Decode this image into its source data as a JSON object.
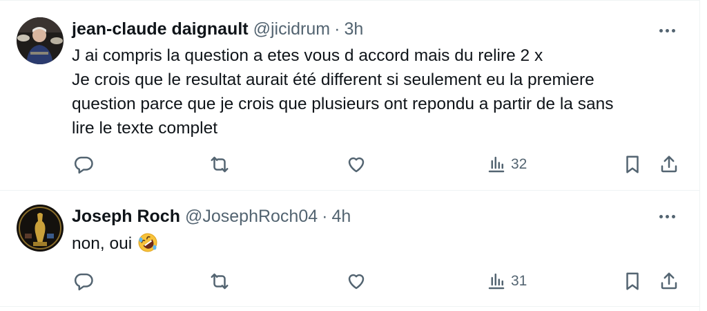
{
  "tweets": [
    {
      "name": "jean-claude daignault",
      "handle": "@jicidrum",
      "separator": "·",
      "time": "3h",
      "lines": [
        "J ai compris la question a etes vous d accord mais du relire 2 x",
        "Je crois que le resultat aurait été different si seulement eu la premiere",
        "question parce que je crois que plusieurs ont repondu a partir de la sans",
        "lire le texte complet"
      ],
      "views": "32"
    },
    {
      "name": "Joseph Roch",
      "handle": "@JosephRoch04",
      "separator": "·",
      "time": "4h",
      "lines": [
        "non, oui"
      ],
      "emoji": "rolling-on-the-floor-laughing",
      "views": "31"
    }
  ],
  "icons": {
    "reply": "reply-icon",
    "retweet": "retweet-icon",
    "like": "heart-icon",
    "views": "views-icon",
    "bookmark": "bookmark-icon",
    "share": "share-icon",
    "more": "more-icon"
  },
  "colors": {
    "text": "#0f1419",
    "secondary": "#536471",
    "border": "#eff3f4"
  }
}
